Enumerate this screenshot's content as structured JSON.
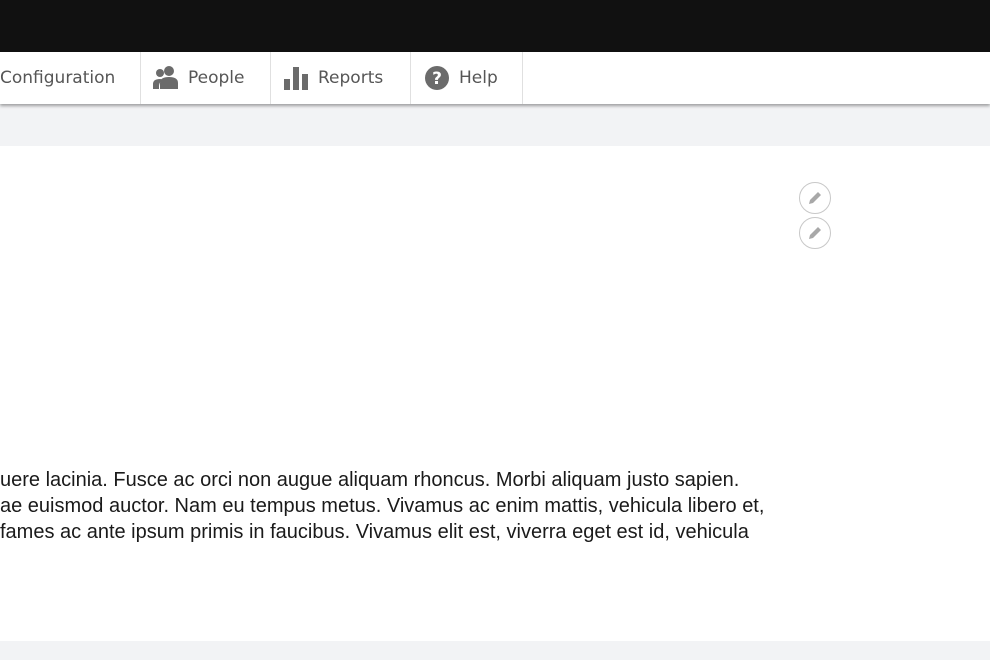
{
  "toolbar": {
    "items": [
      {
        "label": "Configuration",
        "icon": "none"
      },
      {
        "label": "People",
        "icon": "people-icon"
      },
      {
        "label": "Reports",
        "icon": "bar-chart-icon"
      },
      {
        "label": "Help",
        "icon": "help-icon"
      }
    ]
  },
  "content": {
    "edit_buttons": [
      "pencil-icon",
      "pencil-icon"
    ],
    "paragraph_lines": [
      "uere lacinia. Fusce ac orci non augue aliquam rhoncus. Morbi aliquam justo sapien.",
      "ae euismod auctor. Nam eu tempus metus. Vivamus ac enim mattis, vehicula libero et,",
      "fames ac ante ipsum primis in faucibus. Vivamus elit est, viverra eget est id, vehicula"
    ]
  },
  "colors": {
    "topbar": "#111111",
    "toolbar_bg": "#ffffff",
    "toolbar_text": "#565656",
    "page_bg": "#f2f3f5",
    "content_bg": "#ffffff"
  }
}
